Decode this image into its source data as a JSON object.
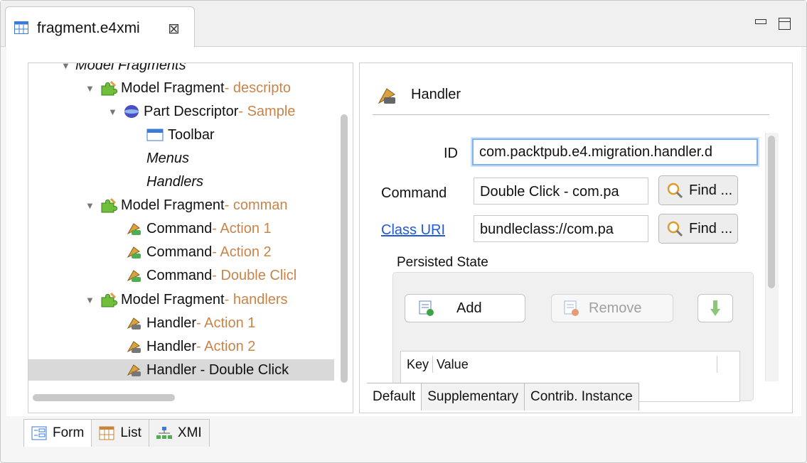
{
  "editor": {
    "tab_title": "fragment.e4xmi",
    "tab_close_symbol": "⊠"
  },
  "tree": {
    "rows": [
      {
        "name": "Model Fragments",
        "suffix": "",
        "italic": true
      },
      {
        "name": "Model Fragment",
        "suffix": " - descripto"
      },
      {
        "name": "Part Descriptor",
        "suffix": " - Sample"
      },
      {
        "name": "Toolbar",
        "suffix": ""
      },
      {
        "name": "Menus",
        "suffix": "",
        "italic": true
      },
      {
        "name": "Handlers",
        "suffix": "",
        "italic": true
      },
      {
        "name": "Model Fragment",
        "suffix": " - comman"
      },
      {
        "name": "Command",
        "suffix": " - Action 1"
      },
      {
        "name": "Command",
        "suffix": " - Action 2"
      },
      {
        "name": "Command",
        "suffix": " - Double Clicl"
      },
      {
        "name": "Model Fragment",
        "suffix": " - handlers"
      },
      {
        "name": "Handler",
        "suffix": " - Action 1"
      },
      {
        "name": "Handler",
        "suffix": " - Action 2"
      },
      {
        "name": "Handler - Double Click",
        "suffix": "",
        "selected": true
      }
    ]
  },
  "detail": {
    "title": "Handler",
    "id_label": "ID",
    "id_value": "com.packtpub.e4.migration.handler.d",
    "command_label": "Command",
    "command_value": "Double Click - com.pa",
    "class_label": "Class URI",
    "class_value": "bundleclass://com.pa",
    "find_label": "Find ...",
    "persisted_state_title": "Persisted State",
    "add_label": "Add",
    "remove_label": "Remove",
    "table_headers": [
      "Key",
      "Value"
    ],
    "tabs": [
      "Default",
      "Supplementary",
      "Contrib. Instance"
    ]
  },
  "bottom_tabs": [
    "Form",
    "List",
    "XMI"
  ],
  "colors": {
    "accent_link": "#1f5bd6",
    "suffix_orange": "#c8844a",
    "selection": "#d9d9d9"
  }
}
